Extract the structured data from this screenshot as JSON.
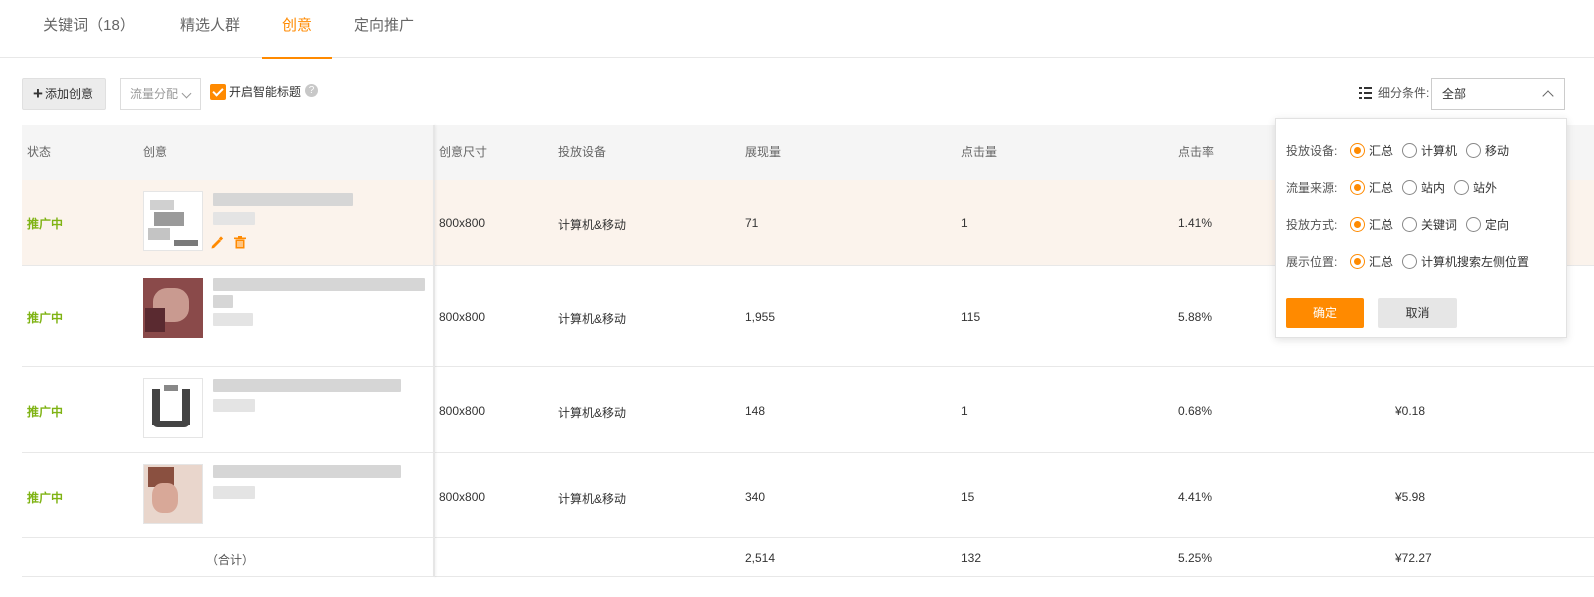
{
  "tabs": [
    {
      "label": "关键词（18）"
    },
    {
      "label": "精选人群"
    },
    {
      "label": "创意"
    },
    {
      "label": "定向推广"
    }
  ],
  "active_tab": "创意",
  "toolbar": {
    "add_label": "添加创意",
    "traffic_select": "流量分配",
    "smart_title_label": "开启智能标题",
    "smart_title_checked": true,
    "help": "?",
    "filter_label": "细分条件:",
    "filter_value": "全部"
  },
  "table": {
    "columns": [
      "状态",
      "创意",
      "创意尺寸",
      "投放设备",
      "展现量",
      "点击量",
      "点击率"
    ],
    "rows": [
      {
        "status": "推广中",
        "size": "800x800",
        "device": "计算机&移动",
        "impressions": "71",
        "clicks": "1",
        "ctr": "1.41%",
        "cost": "",
        "highlighted": true
      },
      {
        "status": "推广中",
        "size": "800x800",
        "device": "计算机&移动",
        "impressions": "1,955",
        "clicks": "115",
        "ctr": "5.88%",
        "cost": ""
      },
      {
        "status": "推广中",
        "size": "800x800",
        "device": "计算机&移动",
        "impressions": "148",
        "clicks": "1",
        "ctr": "0.68%",
        "cost": "¥0.18"
      },
      {
        "status": "推广中",
        "size": "800x800",
        "device": "计算机&移动",
        "impressions": "340",
        "clicks": "15",
        "ctr": "4.41%",
        "cost": "¥5.98"
      }
    ],
    "total": {
      "label": "（合计）",
      "impressions": "2,514",
      "clicks": "132",
      "ctr": "5.25%",
      "cost": "¥72.27"
    }
  },
  "popup": {
    "rows": [
      {
        "label": "投放设备:",
        "options": [
          "汇总",
          "计算机",
          "移动"
        ],
        "selected": 0
      },
      {
        "label": "流量来源:",
        "options": [
          "汇总",
          "站内",
          "站外"
        ],
        "selected": 0
      },
      {
        "label": "投放方式:",
        "options": [
          "汇总",
          "关键词",
          "定向"
        ],
        "selected": 0
      },
      {
        "label": "展示位置:",
        "options": [
          "汇总",
          "计算机搜索左侧位置"
        ],
        "selected": 0
      }
    ],
    "confirm": "确定",
    "cancel": "取消"
  },
  "colors": {
    "accent": "#ff8a00",
    "status": "#7fb314",
    "highlight_row": "#fbf3ec"
  }
}
